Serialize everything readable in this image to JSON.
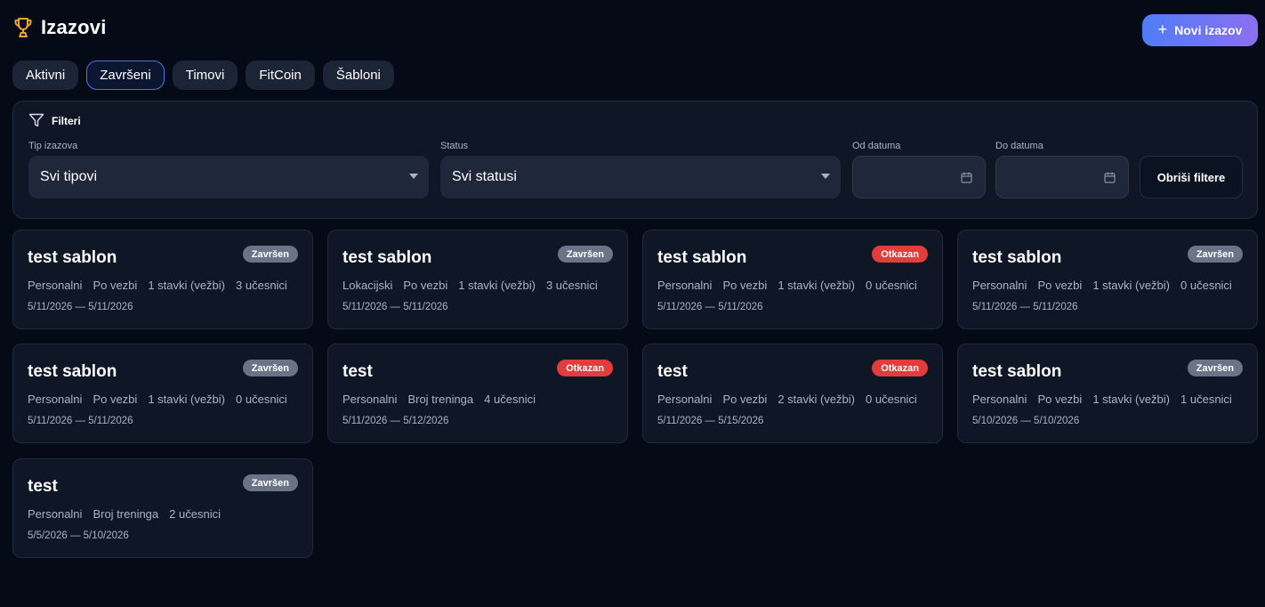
{
  "header": {
    "title": "Izazovi",
    "new_button": "Novi izazov"
  },
  "tabs": [
    {
      "label": "Aktivni"
    },
    {
      "label": "Završeni",
      "active": true
    },
    {
      "label": "Timovi"
    },
    {
      "label": "FitCoin"
    },
    {
      "label": "Šabloni"
    }
  ],
  "filters": {
    "title": "Filteri",
    "type_label": "Tip izazova",
    "type_value": "Svi tipovi",
    "status_label": "Status",
    "status_value": "Svi statusi",
    "from_label": "Od datuma",
    "to_label": "Do datuma",
    "clear_button": "Obriši filtere"
  },
  "colors": {
    "accent": "#4a73e8",
    "done_badge": "#6b7486",
    "cancel_badge": "#e23c3c"
  },
  "cards": [
    {
      "title": "test sablon",
      "status": "Završen",
      "status_kind": "done",
      "meta": [
        "Personalni",
        "Po vezbi",
        "1 stavki (vežbi)",
        "3 učesnici"
      ],
      "dates": "5/11/2026 — 5/11/2026"
    },
    {
      "title": "test sablon",
      "status": "Završen",
      "status_kind": "done",
      "meta": [
        "Lokacijski",
        "Po vezbi",
        "1 stavki (vežbi)",
        "3 učesnici"
      ],
      "dates": "5/11/2026 — 5/11/2026"
    },
    {
      "title": "test sablon",
      "status": "Otkazan",
      "status_kind": "cancel",
      "meta": [
        "Personalni",
        "Po vezbi",
        "1 stavki (vežbi)",
        "0 učesnici"
      ],
      "dates": "5/11/2026 — 5/11/2026"
    },
    {
      "title": "test sablon",
      "status": "Završen",
      "status_kind": "done",
      "meta": [
        "Personalni",
        "Po vezbi",
        "1 stavki (vežbi)",
        "0 učesnici"
      ],
      "dates": "5/11/2026 — 5/11/2026"
    },
    {
      "title": "test sablon",
      "status": "Završen",
      "status_kind": "done",
      "meta": [
        "Personalni",
        "Po vezbi",
        "1 stavki (vežbi)",
        "0 učesnici"
      ],
      "dates": "5/11/2026 — 5/11/2026"
    },
    {
      "title": "test",
      "status": "Otkazan",
      "status_kind": "cancel",
      "meta": [
        "Personalni",
        "Broj treninga",
        "4 učesnici"
      ],
      "dates": "5/11/2026 — 5/12/2026"
    },
    {
      "title": "test",
      "status": "Otkazan",
      "status_kind": "cancel",
      "meta": [
        "Personalni",
        "Po vezbi",
        "2 stavki (vežbi)",
        "0 učesnici"
      ],
      "dates": "5/11/2026 — 5/15/2026"
    },
    {
      "title": "test sablon",
      "status": "Završen",
      "status_kind": "done",
      "meta": [
        "Personalni",
        "Po vezbi",
        "1 stavki (vežbi)",
        "1 učesnici"
      ],
      "dates": "5/10/2026 — 5/10/2026"
    },
    {
      "title": "test",
      "status": "Završen",
      "status_kind": "done",
      "meta": [
        "Personalni",
        "Broj treninga",
        "2 učesnici"
      ],
      "dates": "5/5/2026 — 5/10/2026"
    }
  ]
}
